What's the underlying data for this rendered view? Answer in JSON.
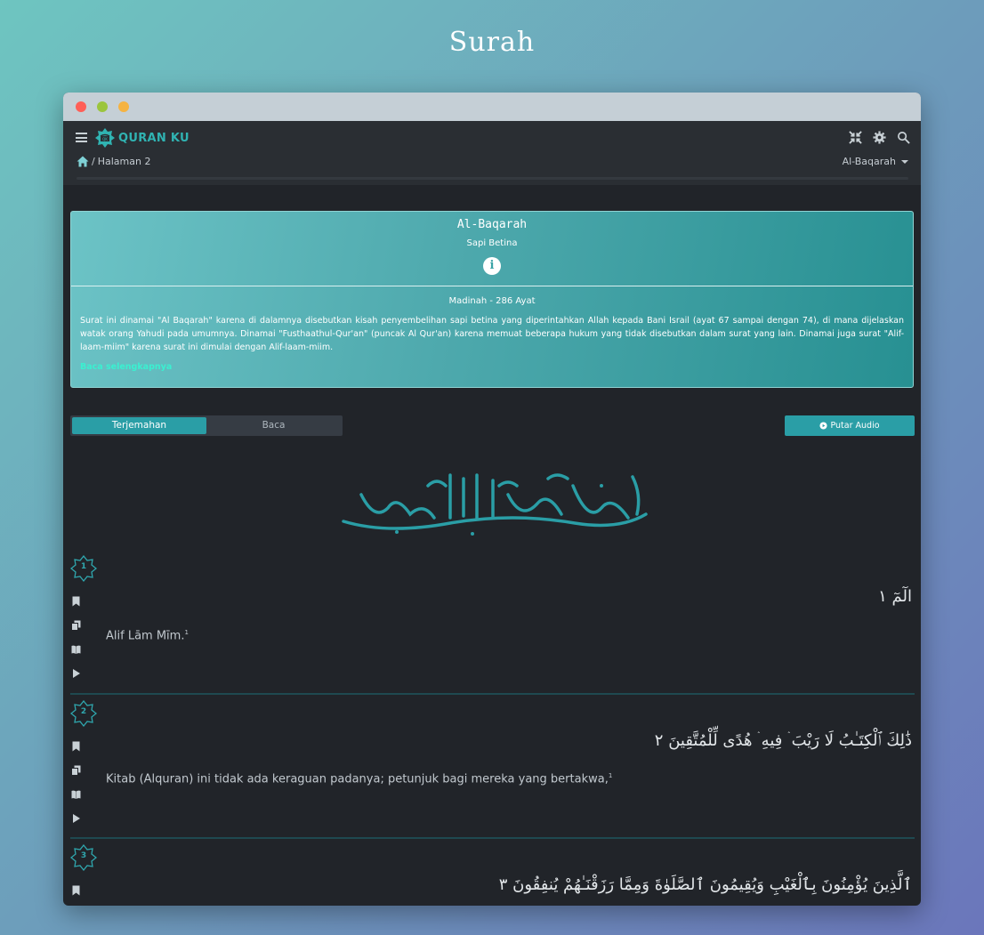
{
  "page": {
    "title": "Surah"
  },
  "app": {
    "logo_text": "QURAN KU",
    "breadcrumb": {
      "sep": "/",
      "current": "Halaman 2"
    },
    "surah_select": "Al-Baqarah"
  },
  "surah": {
    "name": "Al-Baqarah",
    "meaning": "Sapi Betina",
    "info_icon": "i",
    "place_ayat": "Madinah - 286 Ayat",
    "description": "Surat ini dinamai \"Al Baqarah\" karena di dalamnya disebutkan kisah penyembelihan sapi betina yang diperintahkan Allah kepada Bani Israil (ayat 67 sampai dengan 74), di mana dijelaskan watak orang Yahudi pada umumnya. Dinamai \"Fusthaathul-Qur'an\" (puncak Al Qur'an) karena memuat beberapa hukum yang tidak disebutkan dalam surat yang lain. Dinamai juga surat \"Alif-laam-miim\" karena surat ini dimulai dengan Alif-laam-miim.",
    "read_more": "Baca selengkapnya"
  },
  "tabs": [
    {
      "label": "Terjemahan"
    },
    {
      "label": "Baca"
    }
  ],
  "audio_button": "Putar Audio",
  "verses": [
    {
      "number": "1",
      "arabic": "الٓمٓ ١",
      "translation": "Alif Lām Mīm.",
      "footnote": "1"
    },
    {
      "number": "2",
      "arabic": "ذَٰلِكَ ٱلْكِتَـٰبُ لَا رَيْبَ ۛ فِيهِ ۛ هُدًى لِّلْمُتَّقِينَ ٢",
      "translation": "Kitab (Alquran) ini tidak ada keraguan padanya; petunjuk bagi mereka yang bertakwa,",
      "footnote": "1"
    },
    {
      "number": "3",
      "arabic": "ٱلَّذِينَ يُؤْمِنُونَ بِٱلْغَيْبِ وَيُقِيمُونَ ٱلصَّلَوٰةَ وَمِمَّا رَزَقْنَـٰهُمْ يُنفِقُونَ ٣"
    }
  ],
  "colors": {
    "accent": "#2a9ea6",
    "background": "#212429",
    "navbar": "#2a2e33"
  }
}
